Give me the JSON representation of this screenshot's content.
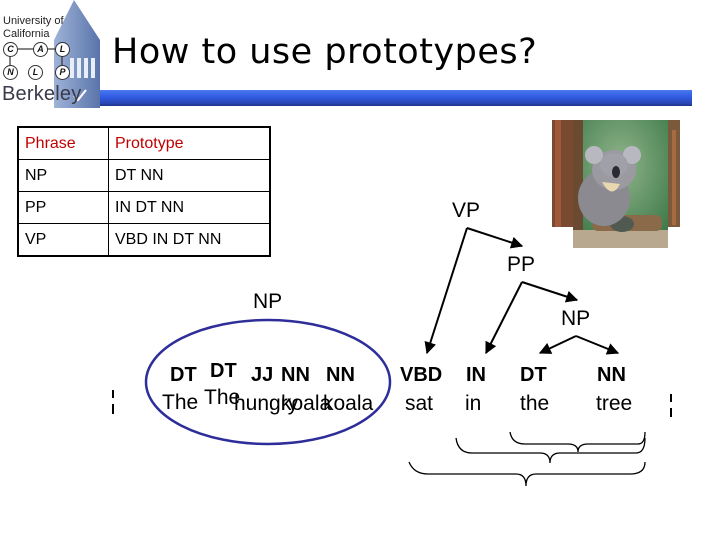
{
  "header": {
    "logo": {
      "line1": "University of",
      "line2": "California",
      "row1_letters": [
        "C",
        "A",
        "L"
      ],
      "row2_letters": [
        "N",
        "L",
        "P"
      ],
      "name": "Berkeley"
    },
    "title": "How to use prototypes?",
    "accent_color": "#2f5ae0"
  },
  "table": {
    "headers": [
      "Phrase",
      "Prototype"
    ],
    "rows": [
      [
        "NP",
        "DT NN"
      ],
      [
        "PP",
        "IN DT NN"
      ],
      [
        "VP",
        "VBD IN DT NN"
      ]
    ],
    "header_color": "#c00000"
  },
  "image": {
    "subject": "koala-photo"
  },
  "tree": {
    "nodes": {
      "vp": "VP",
      "pp": "PP",
      "np_left": "NP",
      "np_right": "NP"
    },
    "tags": {
      "dt1": "DT",
      "dt2": "DT",
      "jj": "JJ",
      "nn1": "NN",
      "nn2": "NN",
      "vbd": "VBD",
      "in": "IN",
      "dt3": "DT",
      "nn3": "NN"
    },
    "words": {
      "the1": "The",
      "the2": "The",
      "hungry": "hungry",
      "koala1": "koala",
      "koala2": "koala",
      "sat": "sat",
      "in": "in",
      "the3": "the",
      "tree": "tree"
    },
    "ellipse_color": "#2e2e9a"
  }
}
